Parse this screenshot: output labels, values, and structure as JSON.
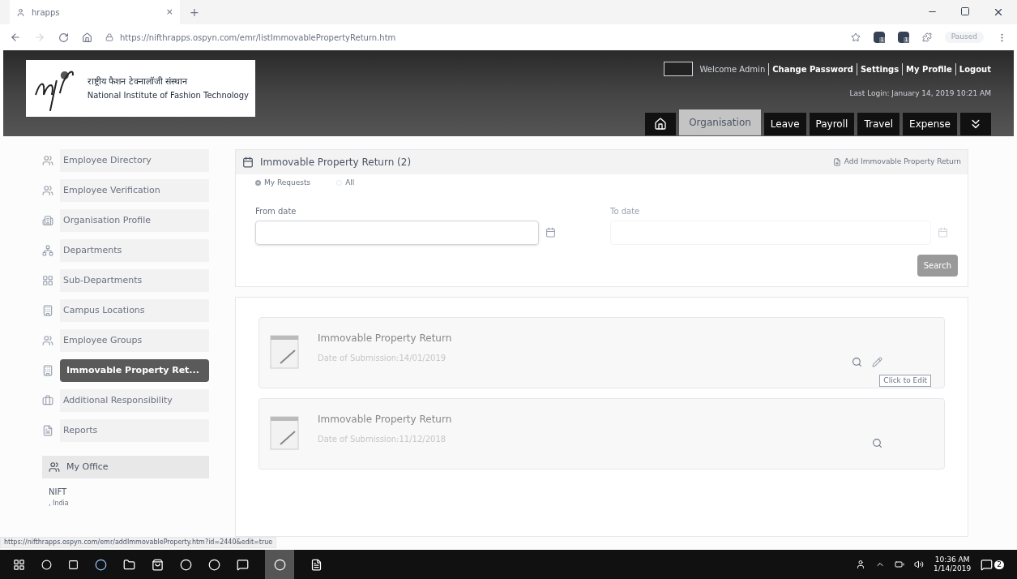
{
  "browser": {
    "tab_title": "hrapps",
    "close": "×",
    "new_tab": "+",
    "url_host": "https://nifthrapps.ospyn.com",
    "url_path": "/emr/listImmovablePropertyReturn.htm",
    "profile": "Paused",
    "badges": [
      "1",
      "1"
    ]
  },
  "header": {
    "org_hindi": "राष्ट्रीय फैशन टेक्नालॉजी संस्थान",
    "org_name": "National Institute of Fashion Technology",
    "welcome": "Welcome Admin",
    "links": [
      "Change Password",
      "Settings",
      "My Profile",
      "Logout"
    ],
    "last_login": "Last Login: January 14, 2019 10:21 AM",
    "tabs": [
      {
        "label": "Organisation",
        "selected": true
      },
      {
        "label": "Leave",
        "selected": false
      },
      {
        "label": "Payroll",
        "selected": false
      },
      {
        "label": "Travel",
        "selected": false
      },
      {
        "label": "Expense",
        "selected": false
      }
    ]
  },
  "sidebar": {
    "items": [
      {
        "label": "Employee Directory",
        "selected": false
      },
      {
        "label": "Employee Verification",
        "selected": false
      },
      {
        "label": "Organisation Profile",
        "selected": false
      },
      {
        "label": "Departments",
        "selected": false
      },
      {
        "label": "Sub-Departments",
        "selected": false
      },
      {
        "label": "Campus Locations",
        "selected": false
      },
      {
        "label": "Employee Groups",
        "selected": false
      },
      {
        "label": "Immovable Property Ret...",
        "selected": true
      },
      {
        "label": "Additional Responsibility",
        "selected": false
      },
      {
        "label": "Reports",
        "selected": false
      }
    ],
    "office_title": "My Office",
    "office_name": "NIFT",
    "office_place": ", India"
  },
  "panel": {
    "title": "Immovable Property Return (2)",
    "add_link": "Add Immovable Property Return",
    "filters": [
      {
        "label": "My Requests",
        "selected": true
      },
      {
        "label": "All",
        "selected": false
      }
    ],
    "from_label": "From date",
    "to_label": "To date",
    "search": "Search"
  },
  "records": [
    {
      "title": "Immovable Property Return",
      "date": "Date of Submission:14/01/2019",
      "editable": true,
      "tooltip": "Click to Edit"
    },
    {
      "title": "Immovable Property Return",
      "date": "Date of Submission:11/12/2018",
      "editable": false
    }
  ],
  "status_url": "https://nifthrapps.ospyn.com/emr/addImmovableProperty.htm?id=2440&edit=true",
  "taskbar": {
    "time": "10:36 AM",
    "date": "1/14/2019",
    "notifications": "2"
  }
}
